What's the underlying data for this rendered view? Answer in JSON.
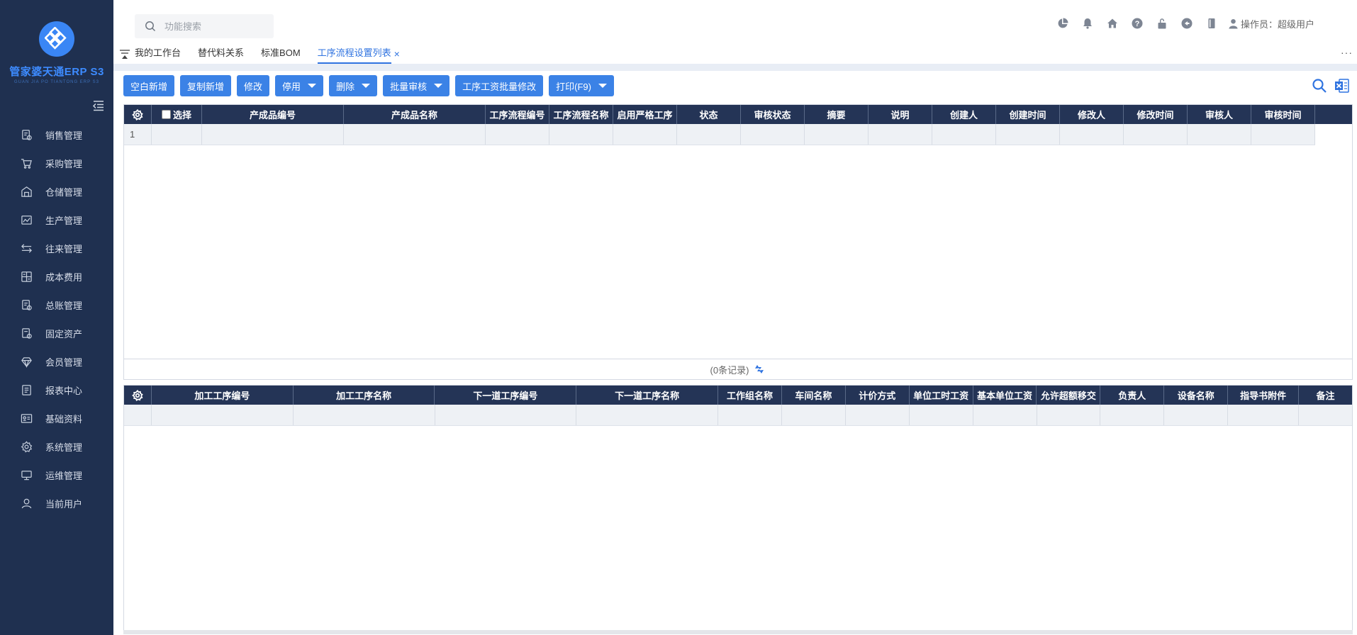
{
  "app": {
    "title": "管家婆天通ERP S3",
    "subtitle": "GUAN JIA PO TIANTONG ERP S3"
  },
  "search": {
    "placeholder": "功能搜索"
  },
  "operator": {
    "label": "操作员：超级用户"
  },
  "top_icons": [
    "chart-pie-icon",
    "bell-icon",
    "home-icon",
    "help-icon",
    "lock-icon",
    "logout-icon",
    "book-icon"
  ],
  "sidebar": {
    "items": [
      {
        "label": "销售管理",
        "icon": "sales-doc-icon"
      },
      {
        "label": "采购管理",
        "icon": "cart-icon"
      },
      {
        "label": "仓储管理",
        "icon": "warehouse-icon"
      },
      {
        "label": "生产管理",
        "icon": "production-icon"
      },
      {
        "label": "往来管理",
        "icon": "exchange-icon"
      },
      {
        "label": "成本费用",
        "icon": "calculator-icon"
      },
      {
        "label": "总账管理",
        "icon": "ledger-icon"
      },
      {
        "label": "固定资产",
        "icon": "asset-icon"
      },
      {
        "label": "会员管理",
        "icon": "diamond-icon"
      },
      {
        "label": "报表中心",
        "icon": "report-icon"
      },
      {
        "label": "基础资料",
        "icon": "id-card-icon"
      },
      {
        "label": "系统管理",
        "icon": "gear-icon"
      },
      {
        "label": "运维管理",
        "icon": "monitor-icon"
      },
      {
        "label": "当前用户",
        "icon": "user-icon"
      }
    ]
  },
  "tabs": [
    {
      "label": "我的工作台"
    },
    {
      "label": "替代料关系"
    },
    {
      "label": "标准BOM"
    },
    {
      "label": "工序流程设置列表",
      "active": true
    }
  ],
  "tab_close": "×",
  "tab_more": "···",
  "toolbar": {
    "buttons": [
      {
        "label": "空白新增",
        "dropdown": false
      },
      {
        "label": "复制新增",
        "dropdown": false
      },
      {
        "label": "修改",
        "dropdown": false
      },
      {
        "label": "停用",
        "dropdown": true
      },
      {
        "label": "删除",
        "dropdown": true
      },
      {
        "label": "批量审核",
        "dropdown": true
      },
      {
        "label": "工序工资批量修改",
        "dropdown": false
      },
      {
        "label": "打印(F9)",
        "dropdown": true
      }
    ]
  },
  "grid_top": {
    "select_label": "选择",
    "columns": [
      "产成品编号",
      "产成品名称",
      "工序流程编号",
      "工序流程名称",
      "启用严格工序",
      "状态",
      "审核状态",
      "摘要",
      "说明",
      "创建人",
      "创建时间",
      "修改人",
      "修改时间",
      "审核人",
      "审核时间"
    ],
    "rows": [
      {
        "index": "1"
      }
    ]
  },
  "footer": {
    "records": "(0条记录)"
  },
  "grid_bottom": {
    "columns": [
      "加工工序编号",
      "加工工序名称",
      "下一道工序编号",
      "下一道工序名称",
      "工作组名称",
      "车间名称",
      "计价方式",
      "单位工时工资",
      "基本单位工资",
      "允许超额移交",
      "负责人",
      "设备名称",
      "指导书附件",
      "备注"
    ]
  },
  "colors": {
    "sidebar_bg": "#1f3050",
    "header_bg": "#243456",
    "accent": "#3b82e6",
    "logo": "#3d8bff"
  }
}
